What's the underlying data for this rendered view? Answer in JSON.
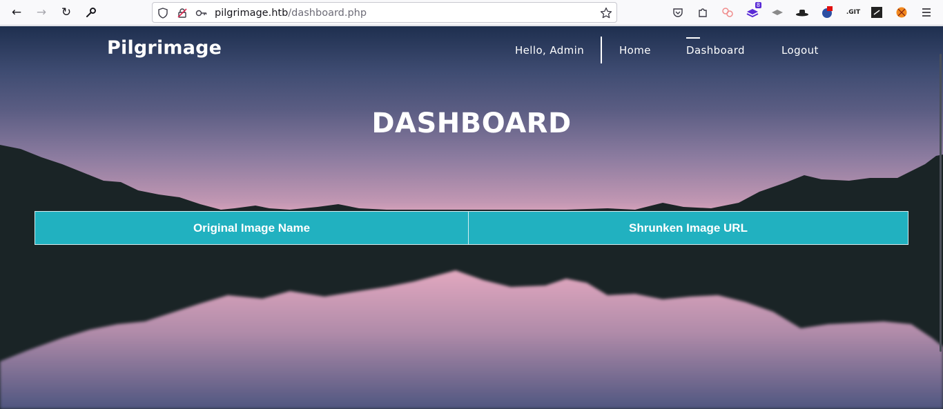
{
  "browser": {
    "url_host": "pilgrimage.htb",
    "url_path": "/dashboard.php",
    "extension_badge": "8",
    "git_label": ".GIT"
  },
  "site": {
    "brand": "Pilgrimage",
    "nav": {
      "greeting": "Hello, Admin",
      "home": "Home",
      "dashboard": "Dashboard",
      "logout": "Logout"
    },
    "active_nav": "Dashboard"
  },
  "main": {
    "title": "DASHBOARD",
    "table": {
      "headers": [
        "Original Image Name",
        "Shrunken Image URL"
      ],
      "rows": []
    }
  },
  "colors": {
    "accent": "#21b1c0",
    "sky_top": "#1e2f4f",
    "sky_bottom": "#e2a8bf",
    "mountain": "#1a2426"
  }
}
